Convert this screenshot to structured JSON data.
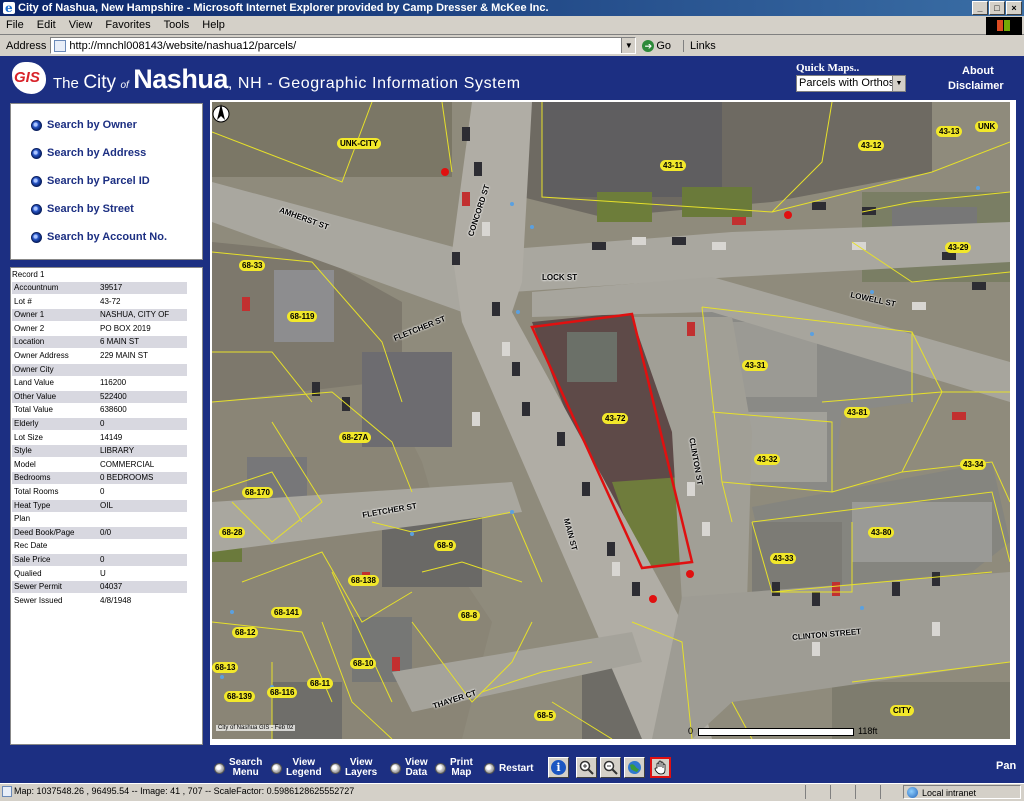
{
  "window": {
    "title": "City of Nashua, New Hampshire - Microsoft Internet Explorer provided by Camp Dresser & McKee Inc."
  },
  "menu": [
    "File",
    "Edit",
    "View",
    "Favorites",
    "Tools",
    "Help"
  ],
  "address_bar": {
    "label": "Address",
    "url": "http://mnchl008143/website/nashua12/parcels/",
    "go_label": "Go",
    "links_label": "Links"
  },
  "header": {
    "logo_text": "GIS",
    "title_the": "The",
    "title_city": "City",
    "title_of": "of",
    "title_name": "Nashua",
    "title_rest": ", NH - Geographic Information System",
    "quickmaps_label": "Quick Maps..",
    "quickmaps_value": "Parcels with Orthos",
    "about": "About",
    "disclaimer": "Disclaimer"
  },
  "search": {
    "items": [
      "Search by Owner",
      "Search by Address",
      "Search by Parcel ID",
      "Search by Street",
      "Search by Account No."
    ]
  },
  "record": {
    "heading": "Record 1",
    "rows": [
      {
        "label": "Accountnum",
        "value": "39517"
      },
      {
        "label": "Lot #",
        "value": "43-72"
      },
      {
        "label": "Owner 1",
        "value": "NASHUA, CITY OF"
      },
      {
        "label": "Owner 2",
        "value": "PO BOX 2019"
      },
      {
        "label": "Location",
        "value": "6 MAIN ST"
      },
      {
        "label": "Owner Address",
        "value": "229 MAIN ST"
      },
      {
        "label": "Owner City",
        "value": ""
      },
      {
        "label": "Land Value",
        "value": "116200"
      },
      {
        "label": "Other Value",
        "value": "522400"
      },
      {
        "label": "Total Value",
        "value": "638600"
      },
      {
        "label": "Elderly",
        "value": "0"
      },
      {
        "label": "Lot Size",
        "value": "14149"
      },
      {
        "label": "Style",
        "value": "LIBRARY"
      },
      {
        "label": "Model",
        "value": "COMMERCIAL"
      },
      {
        "label": "Bedrooms",
        "value": "0 BEDROOMS"
      },
      {
        "label": "Total Rooms",
        "value": "0"
      },
      {
        "label": "Heat Type",
        "value": "OIL"
      },
      {
        "label": "Plan",
        "value": ""
      },
      {
        "label": "Deed Book/Page",
        "value": "0/0"
      },
      {
        "label": "Rec Date",
        "value": ""
      },
      {
        "label": "Sale Price",
        "value": "0"
      },
      {
        "label": "Qualied",
        "value": "U"
      },
      {
        "label": "Sewer Permit",
        "value": "04037"
      },
      {
        "label": "Sewer Issued",
        "value": "4/8/1948"
      }
    ]
  },
  "map": {
    "parcels": [
      "UNK-CITY",
      "43-11",
      "43-12",
      "43-13",
      "UNK",
      "43-29",
      "68-33",
      "68-119",
      "43-72",
      "43-31",
      "43-81",
      "43-32",
      "43-34",
      "68-27A",
      "68-170",
      "68-28",
      "43-80",
      "68-9",
      "43-33",
      "68-138",
      "68-141",
      "68-8",
      "68-12",
      "68-13",
      "68-10",
      "68-116",
      "68-11",
      "68-139",
      "68-5",
      "CITY"
    ],
    "streets": [
      "AMHERST ST",
      "CONCORD ST",
      "LOCK ST",
      "LOWELL ST",
      "FLETCHER ST",
      "CLINTON ST",
      "FLETCHER ST",
      "MAIN ST",
      "CLINTON STREET",
      "THAYER CT"
    ],
    "credit": "City of Nashua GIS - Feb 02",
    "scale_start": "0",
    "scale_end": "118ft"
  },
  "toolbar": {
    "search_menu": [
      "Search",
      "Menu"
    ],
    "view_legend": [
      "View",
      "Legend"
    ],
    "view_layers": [
      "View",
      "Layers"
    ],
    "view_data": [
      "View",
      "Data"
    ],
    "print_map": [
      "Print",
      "Map"
    ],
    "restart": "Restart",
    "pan": "Pan"
  },
  "status": {
    "text": "Map: 1037548.26 , 96495.54 -- Image: 41 , 707 -- ScaleFactor: 0.5986128625552727",
    "zone": "Local intranet"
  }
}
